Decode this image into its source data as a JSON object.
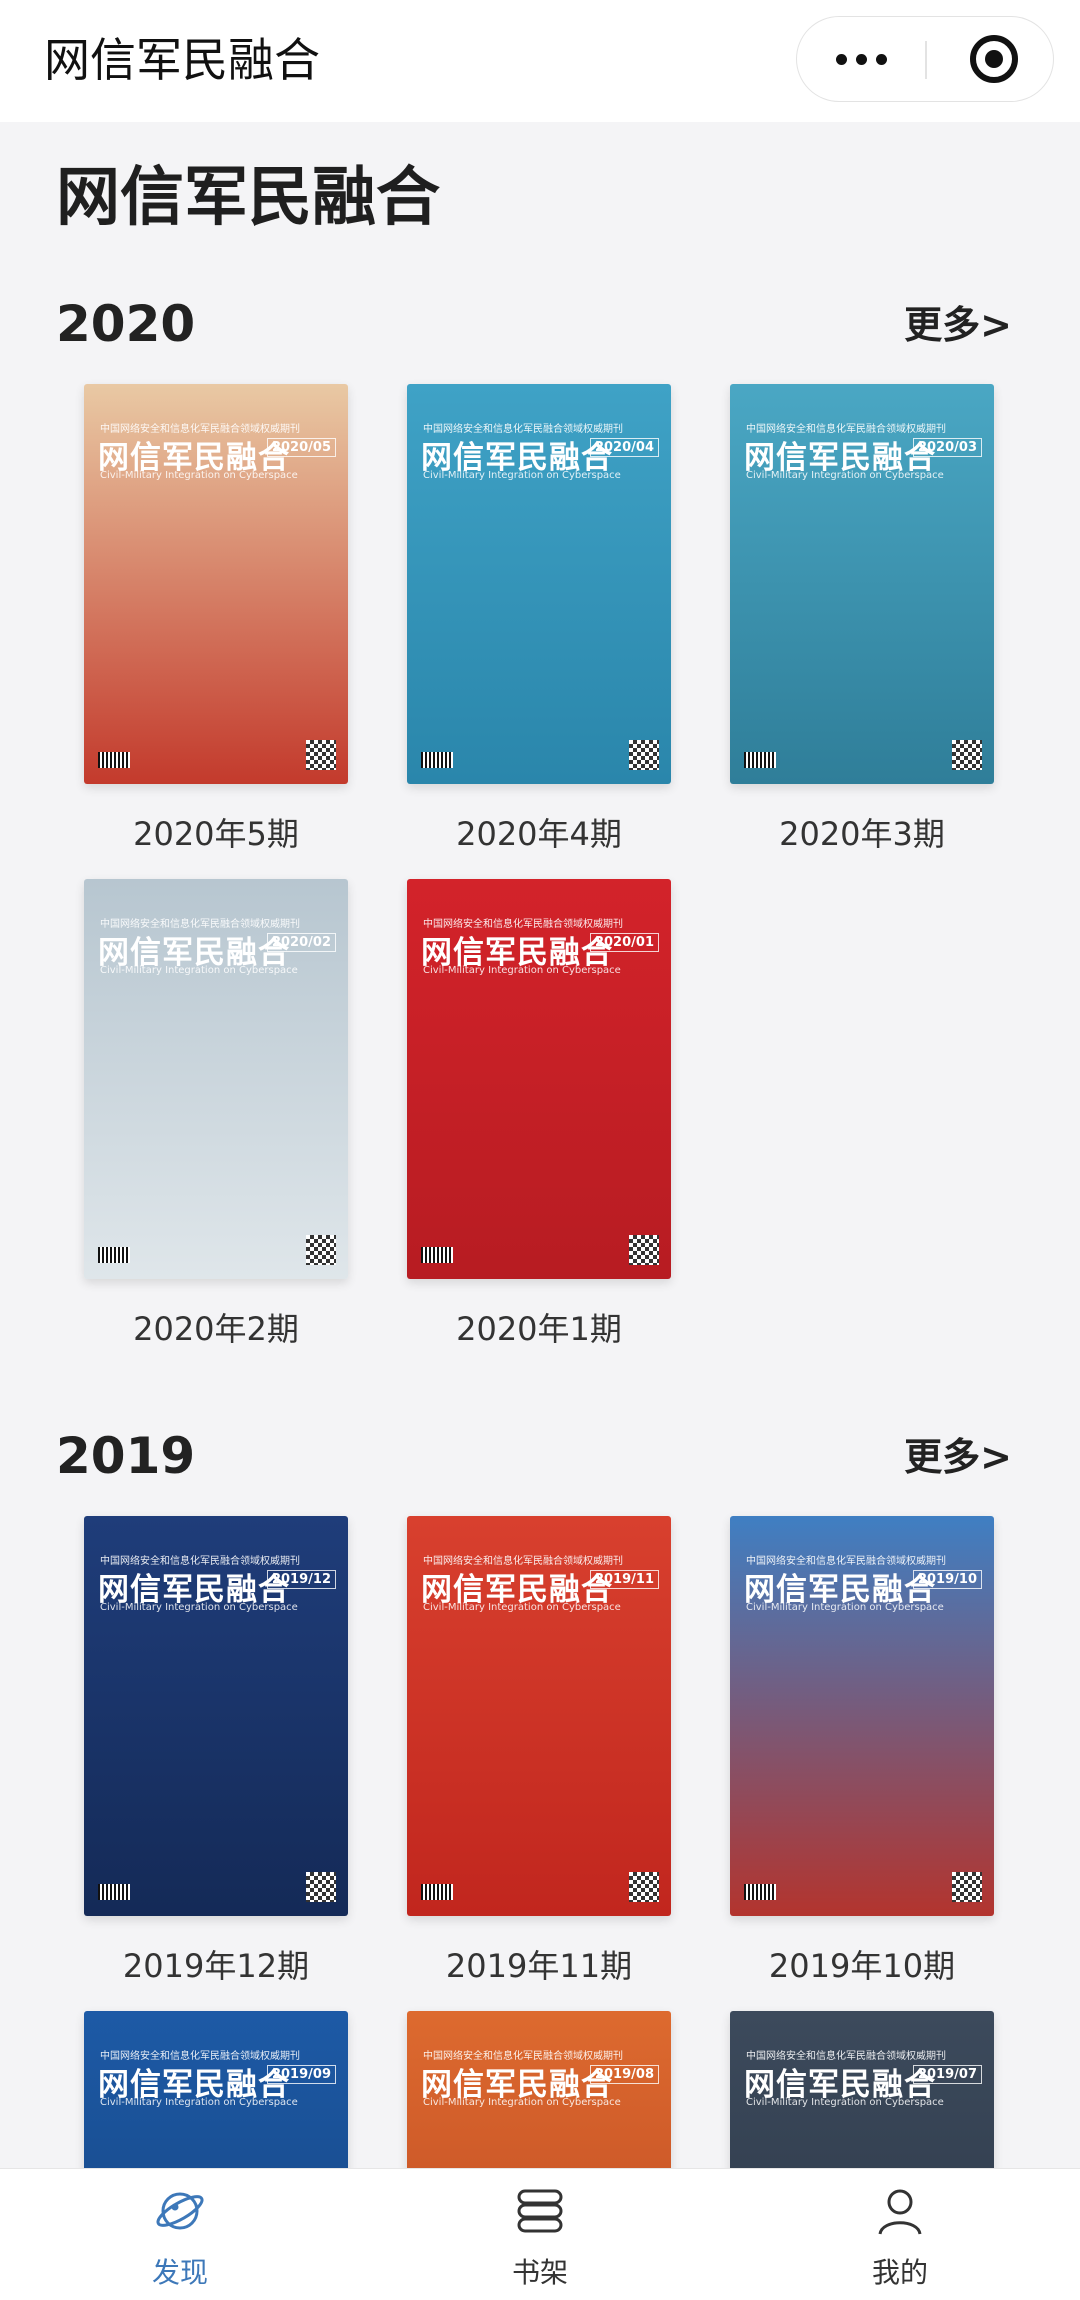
{
  "navbar": {
    "title": "网信军民融合"
  },
  "page": {
    "title": "网信军民融合"
  },
  "sections": [
    {
      "year": "2020",
      "more_label": "更多>",
      "issues": [
        {
          "label": "2020年5期",
          "cover": {
            "masthead": "网信军民融合",
            "issue": "2020/05",
            "bg": "#e9c9a4",
            "bg2": "#c33a2c"
          }
        },
        {
          "label": "2020年4期",
          "cover": {
            "masthead": "网信军民融合",
            "issue": "2020/04",
            "bg": "#3fa2c6",
            "bg2": "#2a86ab"
          }
        },
        {
          "label": "2020年3期",
          "cover": {
            "masthead": "网信军民融合",
            "issue": "2020/03",
            "bg": "#4aa7c4",
            "bg2": "#2f7e99"
          }
        },
        {
          "label": "2020年2期",
          "cover": {
            "masthead": "网信军民融合",
            "issue": "2020/02",
            "bg": "#b7c6d0",
            "bg2": "#dfe6ea"
          }
        },
        {
          "label": "2020年1期",
          "cover": {
            "masthead": "网信军民融合",
            "issue": "2020/01",
            "bg": "#d3232a",
            "bg2": "#b71c22"
          }
        }
      ]
    },
    {
      "year": "2019",
      "more_label": "更多>",
      "issues": [
        {
          "label": "2019年12期",
          "cover": {
            "masthead": "网信军民融合",
            "issue": "2019/12",
            "bg": "#1f3d7a",
            "bg2": "#142a57"
          }
        },
        {
          "label": "2019年11期",
          "cover": {
            "masthead": "网信军民融合",
            "issue": "2019/11",
            "bg": "#d8402e",
            "bg2": "#c1261e"
          }
        },
        {
          "label": "2019年10期",
          "cover": {
            "masthead": "网信军民融合",
            "issue": "2019/10",
            "bg": "#3f7fc3",
            "bg2": "#b3342e"
          }
        },
        {
          "label": "",
          "cover": {
            "masthead": "网信军民融合",
            "issue": "2019/09",
            "bg": "#1d5aa6",
            "bg2": "#143f78"
          }
        },
        {
          "label": "",
          "cover": {
            "masthead": "网信军民融合",
            "issue": "2019/08",
            "bg": "#dd6a2f",
            "bg2": "#b84320"
          }
        },
        {
          "label": "",
          "cover": {
            "masthead": "网信军民融合",
            "issue": "2019/07",
            "bg": "#3c4a5c",
            "bg2": "#2a3544"
          }
        }
      ]
    }
  ],
  "cover_common": {
    "series": "中国网络安全和信息化军民融合领域权威期刊",
    "english": "Civil-Military Integration on Cyberspace"
  },
  "tabbar": {
    "items": [
      {
        "label": "发现",
        "icon": "planet-icon",
        "active": true
      },
      {
        "label": "书架",
        "icon": "bookshelf-icon",
        "active": false
      },
      {
        "label": "我的",
        "icon": "user-icon",
        "active": false
      }
    ],
    "active_color": "#3d78b9"
  }
}
